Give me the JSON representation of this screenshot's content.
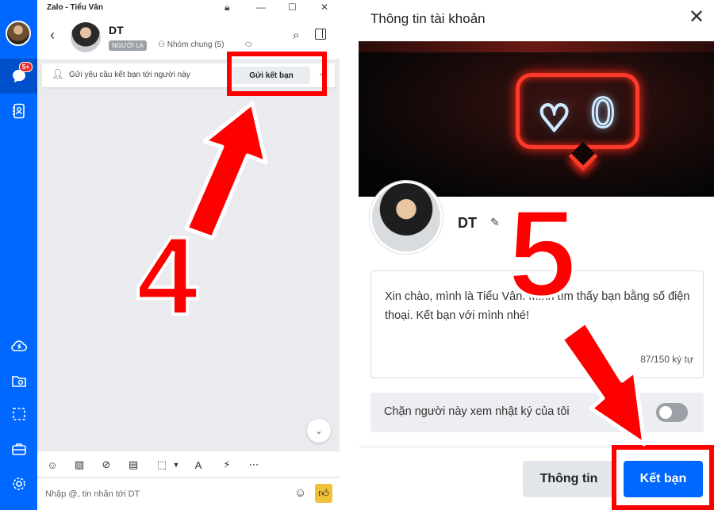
{
  "zalo": {
    "window_title": "Zalo - Tiểu Vân",
    "sidebar_badge": "5+",
    "chat_name": "DT",
    "stranger_tag": "NGƯỜI LẠ",
    "common_groups": "Nhóm chung (5)",
    "friend_request_text": "Gửi yêu cầu kết bạn tới người này",
    "friend_request_button": "Gửi kết bạn",
    "composer_placeholder": "Nhập @, tin nhắn tới DT"
  },
  "dialog": {
    "title": "Thông tin tài khoản",
    "profile_name": "DT",
    "message": "Xin chào, mình là Tiểu Vân. Mình tìm thấy bạn bằng số điện thoại. Kết bạn với mình nhé!",
    "char_count": "87/150 ký tự",
    "block_label": "Chặn người này xem nhật ký của tôi",
    "block_toggle_on": false,
    "info_button": "Thông tin",
    "add_friend_button": "Kết bạn"
  },
  "annotations": {
    "step_left": "4",
    "step_right": "5",
    "annotation_color": "#ff0000"
  },
  "colors": {
    "zalo_blue": "#0068ff"
  }
}
